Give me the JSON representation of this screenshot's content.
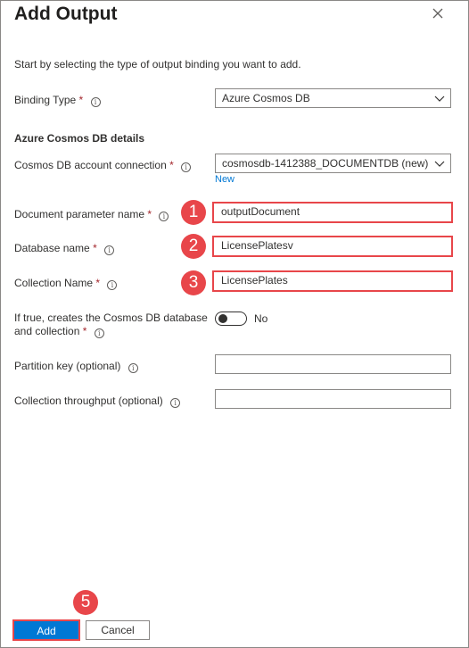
{
  "dialog": {
    "title": "Add Output",
    "intro": "Start by selecting the type of output binding you want to add."
  },
  "binding_type": {
    "label": "Binding Type",
    "required_mark": "*",
    "info_glyph": "i",
    "value": "Azure Cosmos DB"
  },
  "section_title": "Azure Cosmos DB details",
  "account_connection": {
    "label": "Cosmos DB account connection",
    "required_mark": "*",
    "info_glyph": "i",
    "value": "cosmosdb-1412388_DOCUMENTDB (new)",
    "new_link": "New"
  },
  "document_param": {
    "label": "Document parameter name",
    "required_mark": "*",
    "info_glyph": "i",
    "value": "outputDocument",
    "step": "1"
  },
  "database_name": {
    "label": "Database name",
    "required_mark": "*",
    "info_glyph": "i",
    "value": "LicensePlatesv",
    "step": "2"
  },
  "collection_name": {
    "label": "Collection Name",
    "required_mark": "*",
    "info_glyph": "i",
    "value": "LicensePlates",
    "step": "3"
  },
  "create_if_missing": {
    "label_line1": "If true, creates the Cosmos DB database",
    "label_line2": "and collection",
    "required_mark": "*",
    "info_glyph": "i",
    "toggle_text": "No",
    "toggle_on": false
  },
  "partition_key": {
    "label": "Partition key (optional)",
    "info_glyph": "i",
    "value": ""
  },
  "throughput": {
    "label": "Collection throughput (optional)",
    "info_glyph": "i",
    "value": ""
  },
  "footer": {
    "add_label": "Add",
    "cancel_label": "Cancel",
    "add_step": "5"
  },
  "colors": {
    "accent": "#0078d4",
    "highlight": "#e8464a",
    "required": "#a4262c"
  },
  "icons": {
    "close": "close-icon",
    "chevron": "chevron-down-icon",
    "info": "info-icon"
  }
}
